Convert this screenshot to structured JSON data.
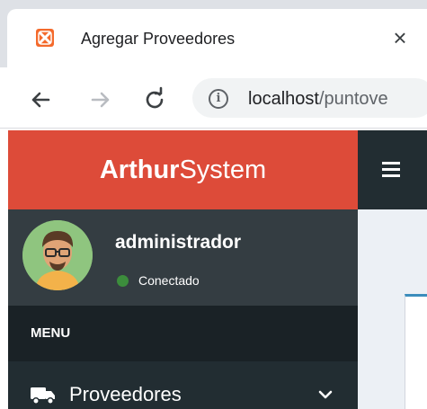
{
  "browser": {
    "tab_title": "Agregar Proveedores",
    "tab_close": "×",
    "url_host": "localhost",
    "url_path": "/puntove",
    "favicon": "xampp-icon"
  },
  "app": {
    "brand_bold": "Arthur",
    "brand_rest": "System",
    "brand_color": "#dd4b39",
    "sidebar_color": "#222d32"
  },
  "user": {
    "name": "administrador",
    "status": "Conectado",
    "status_color": "#3c8d3c"
  },
  "sidebar": {
    "header": "MENU",
    "items": [
      {
        "label": "Proveedores",
        "icon": "truck-icon",
        "expand_icon": "chevron-down-icon"
      }
    ]
  }
}
